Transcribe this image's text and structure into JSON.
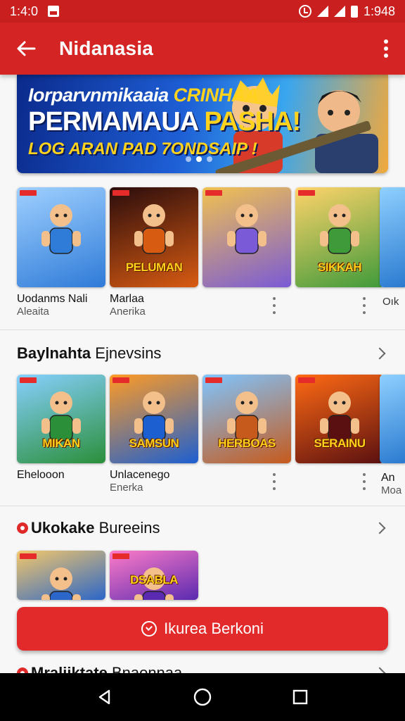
{
  "status_bar": {
    "time_left": "1:4:0",
    "time_right": "1:948"
  },
  "app_bar": {
    "title": "Nidanasia"
  },
  "banner": {
    "line1_a": "Iorparvnmikaaia ",
    "line1_b": "CRINHAA",
    "line2_a": "PERMAMAUA ",
    "line2_b": "PASHA!",
    "line3": "LOG ARAN PAD 7ONDSAIP !"
  },
  "row1": {
    "cards": [
      {
        "name": "Uodanms Nali",
        "sub": "Aleaita",
        "caption": "",
        "colors": [
          "#2f7bd8",
          "#9fd0ff"
        ]
      },
      {
        "name": "Marlaa",
        "sub": "Anerika",
        "caption": "PELUMAN",
        "colors": [
          "#d85b12",
          "#2a0c0c"
        ]
      },
      {
        "name": "",
        "sub": "",
        "caption": "",
        "colors": [
          "#7a5ad6",
          "#f2c24f"
        ]
      },
      {
        "name": "",
        "sub": "",
        "caption": "SIKKAH",
        "colors": [
          "#3f9a3a",
          "#ffd36a"
        ]
      }
    ],
    "overflow_label": "Oık"
  },
  "section1": {
    "title_bold": "Baylnahta",
    "title_rest": " Ejnevsins"
  },
  "row2": {
    "cards": [
      {
        "name": "Ehelooon",
        "sub": "",
        "caption": "MIKAN",
        "colors": [
          "#2b8f3a",
          "#86d0ff"
        ]
      },
      {
        "name": "Unlacenego",
        "sub": "Enerka",
        "caption": "SAMSUN",
        "colors": [
          "#1c5fd1",
          "#ff9b24"
        ]
      },
      {
        "name": "",
        "sub": "",
        "caption": "HERBOAS",
        "colors": [
          "#c65a1c",
          "#7fc5ff"
        ]
      },
      {
        "name": "",
        "sub": "",
        "caption": "SERAINU",
        "colors": [
          "#5a1010",
          "#ff6a14"
        ]
      }
    ],
    "overflow_name": "An",
    "overflow_sub": "Moa"
  },
  "section2": {
    "title_bold": "Ukokake",
    "title_rest": " Bureeins"
  },
  "row3": {
    "cards": [
      {
        "caption": "",
        "colors": [
          "#2b66c8",
          "#f5c86a"
        ]
      },
      {
        "caption": "DSABLA",
        "colors": [
          "#5a2ab0",
          "#ff7cc8"
        ]
      }
    ]
  },
  "cta": {
    "label": "Ikurea Berkoni"
  },
  "section3": {
    "title_bold": "Mraliiktate",
    "title_rest": " Bnaonnaa"
  },
  "colors": {
    "primary": "#d42424",
    "status_bar": "#c91f1f"
  }
}
